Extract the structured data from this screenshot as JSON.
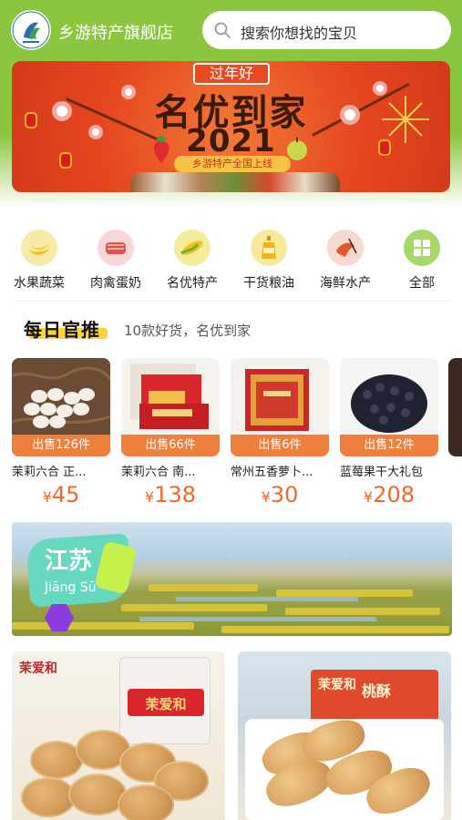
{
  "header": {
    "store_name": "乡游特产旗舰店",
    "search_placeholder": "搜索你想找的宝贝",
    "logo_icon": "store-logo-icon",
    "search_icon": "search-icon"
  },
  "banner": {
    "tag": "过年好",
    "title": "名优到家",
    "year": "2021",
    "subtitle": "乡游特产全国上线"
  },
  "categories": [
    {
      "label": "水果蔬菜",
      "icon": "fruit-veg-icon",
      "color": "#f9e9a6"
    },
    {
      "label": "肉禽蛋奶",
      "icon": "meat-icon",
      "color": "#f9d7d7"
    },
    {
      "label": "名优特产",
      "icon": "corn-icon",
      "color": "#f4eb9b"
    },
    {
      "label": "干货粮油",
      "icon": "oil-icon",
      "color": "#f8ea9a"
    },
    {
      "label": "海鲜水产",
      "icon": "seafood-icon",
      "color": "#f9d8cf"
    },
    {
      "label": "全部",
      "icon": "grid-icon",
      "color": "#a8d86a"
    }
  ],
  "daily": {
    "title": "每日官推",
    "subtitle": "10款好货，名优到家"
  },
  "products": [
    {
      "sold": "出售126件",
      "name": "茉莉六合 正...",
      "currency": "¥",
      "price": "45"
    },
    {
      "sold": "出售66件",
      "name": "茉莉六合 南...",
      "currency": "¥",
      "price": "138"
    },
    {
      "sold": "出售6件",
      "name": "常州五香萝卜...",
      "currency": "¥",
      "price": "30"
    },
    {
      "sold": "出售12件",
      "name": "蓝莓果干大礼包",
      "currency": "¥",
      "price": "208"
    }
  ],
  "region": {
    "name": "江苏",
    "pinyin": "Jiāng Sū"
  },
  "cards": [
    {
      "brand": "茉爱和",
      "pack_label": "茉爱和"
    },
    {
      "brand": "茉爱和",
      "pack_label": "桃酥"
    }
  ],
  "colors": {
    "accent_green": "#8cc63f",
    "sold_orange": "#ef7f3c",
    "price_orange": "#ee6a2c"
  }
}
